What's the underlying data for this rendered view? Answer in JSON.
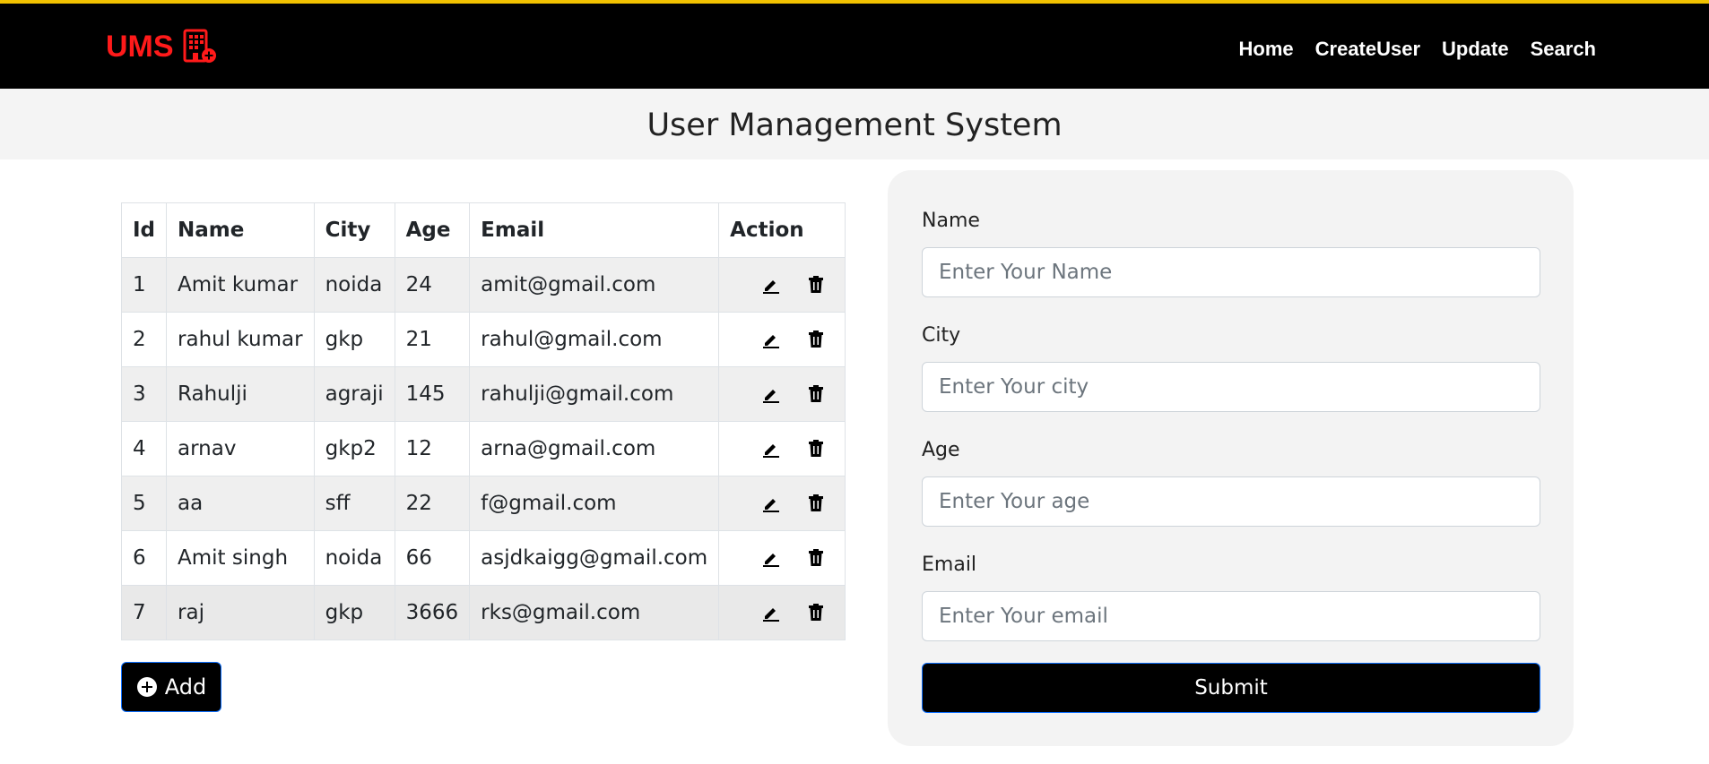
{
  "header": {
    "brand": "UMS",
    "brand_icon": "building-plus-icon",
    "nav": [
      "Home",
      "CreateUser",
      "Update",
      "Search"
    ]
  },
  "page_title": "User Management System",
  "table": {
    "columns": [
      "Id",
      "Name",
      "City",
      "Age",
      "Email",
      "Action"
    ],
    "rows": [
      [
        "1",
        "Amit kumar",
        "noida",
        "24",
        "amit@gmail.com"
      ],
      [
        "2",
        "rahul kumar",
        "gkp",
        "21",
        "rahul@gmail.com"
      ],
      [
        "3",
        "Rahulji",
        "agraji",
        "145",
        "rahulji@gmail.com"
      ],
      [
        "4",
        "arnav",
        "gkp2",
        "12",
        "arna@gmail.com"
      ],
      [
        "5",
        "aa",
        "sff",
        "22",
        "f@gmail.com"
      ],
      [
        "6",
        "Amit singh",
        "noida",
        "66",
        "asjdkaigg@gmail.com"
      ],
      [
        "7",
        "raj",
        "gkp",
        "3666",
        "rks@gmail.com"
      ]
    ],
    "row_actions": [
      "edit-icon",
      "delete-icon"
    ]
  },
  "add_button": {
    "label": "Add",
    "icon": "plus-circle-icon"
  },
  "form": {
    "name_label": "Name",
    "name_placeholder": "Enter Your Name",
    "city_label": "City",
    "city_placeholder": "Enter Your city",
    "age_label": "Age",
    "age_placeholder": "Enter Your age",
    "email_label": "Email",
    "email_placeholder": "Enter Your email",
    "submit_label": "Submit"
  },
  "colors": {
    "brand": "#ff1a1a",
    "navbar": "#000000",
    "accent_border": "#f2c200"
  }
}
